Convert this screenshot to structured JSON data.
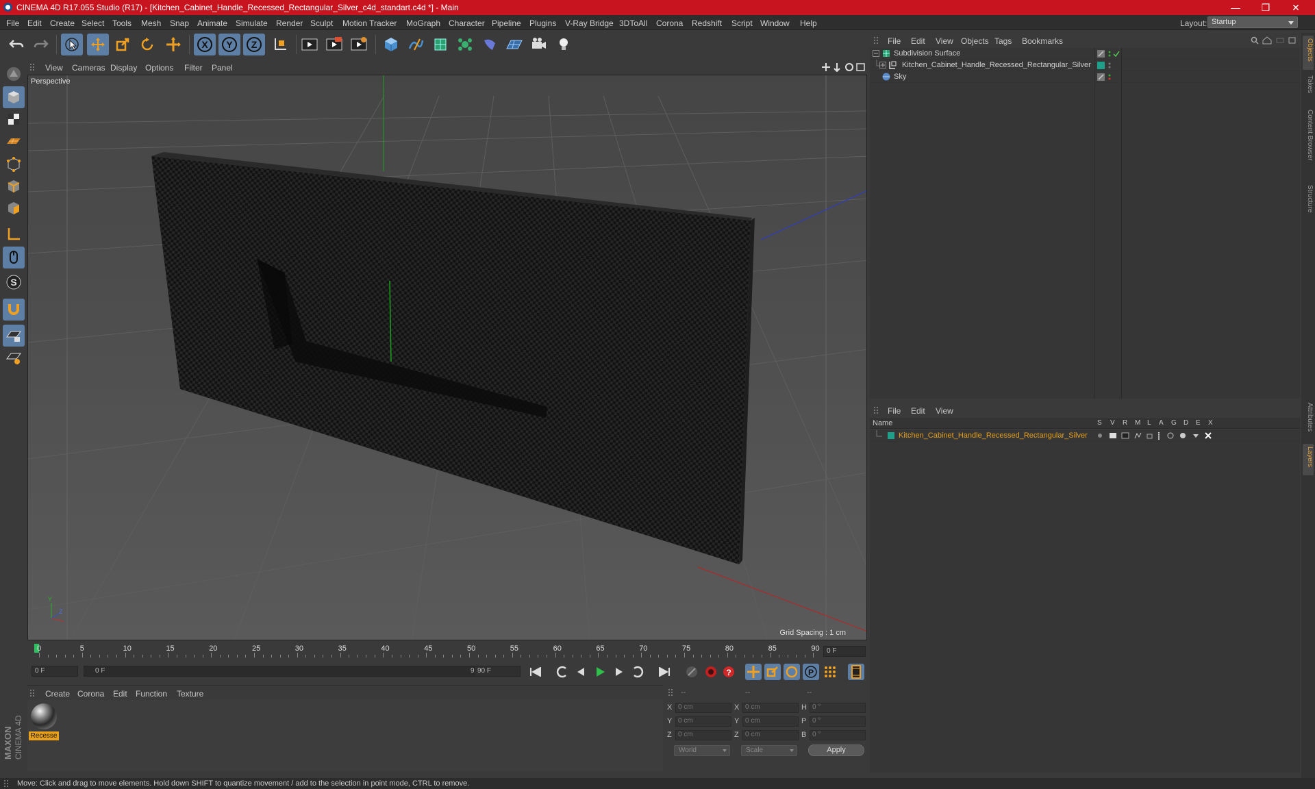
{
  "window": {
    "title": "CINEMA 4D R17.055 Studio (R17) - [Kitchen_Cabinet_Handle_Recessed_Rectangular_Silver_c4d_standart.c4d *] - Main"
  },
  "menubar": {
    "items": [
      "File",
      "Edit",
      "Create",
      "Select",
      "Tools",
      "Mesh",
      "Snap",
      "Animate",
      "Simulate",
      "Render",
      "Sculpt",
      "Motion Tracker",
      "MoGraph",
      "Character",
      "Pipeline",
      "Plugins",
      "V-Ray Bridge",
      "3DToAll",
      "Corona",
      "Redshift",
      "Script",
      "Window",
      "Help"
    ],
    "layout_label": "Layout:",
    "layout_value": "Startup"
  },
  "viewport": {
    "menu": [
      "View",
      "Cameras",
      "Display",
      "Options",
      "Filter",
      "Panel"
    ],
    "label": "Perspective",
    "grid_spacing": "Grid Spacing : 1 cm"
  },
  "timeline": {
    "ticks": [
      "0",
      "5",
      "10",
      "15",
      "20",
      "25",
      "30",
      "35",
      "40",
      "45",
      "50",
      "55",
      "60",
      "65",
      "70",
      "75",
      "80",
      "85",
      "90"
    ],
    "current_frame": "0 F",
    "start_field": "0 F",
    "slider_start": "0 F",
    "slider_end": "90 F",
    "end_field": "90 F"
  },
  "material_panel": {
    "menu": [
      "Create",
      "Corona",
      "Edit",
      "Function",
      "Texture"
    ],
    "material_name": "Recesse"
  },
  "coords": {
    "headers": [
      "--",
      "--",
      "--"
    ],
    "rows": [
      {
        "l1": "X",
        "v1": "0 cm",
        "l2": "X",
        "v2": "0 cm",
        "l3": "H",
        "v3": "0 °"
      },
      {
        "l1": "Y",
        "v1": "0 cm",
        "l2": "Y",
        "v2": "0 cm",
        "l3": "P",
        "v3": "0 °"
      },
      {
        "l1": "Z",
        "v1": "0 cm",
        "l2": "Z",
        "v2": "0 cm",
        "l3": "B",
        "v3": "0 °"
      }
    ],
    "world": "World",
    "scale": "Scale",
    "apply": "Apply"
  },
  "object_manager": {
    "menu": [
      "File",
      "Edit",
      "View",
      "Objects",
      "Tags",
      "Bookmarks"
    ],
    "objects": [
      {
        "name": "Subdivision Surface"
      },
      {
        "name": "Kitchen_Cabinet_Handle_Recessed_Rectangular_Silver"
      },
      {
        "name": "Sky"
      }
    ]
  },
  "layer_manager": {
    "menu": [
      "File",
      "Edit",
      "View"
    ],
    "header_name": "Name",
    "columns": [
      "S",
      "V",
      "R",
      "M",
      "L",
      "A",
      "G",
      "D",
      "E",
      "X"
    ],
    "layers": [
      {
        "name": "Kitchen_Cabinet_Handle_Recessed_Rectangular_Silver"
      }
    ]
  },
  "right_tabs": [
    "Objects",
    "Takes",
    "Content Browser",
    "Structure",
    "Attributes",
    "Layers"
  ],
  "brand": {
    "line1": "MAXON",
    "line2": "CINEMA 4D"
  },
  "status": {
    "text": "Move: Click and drag to move elements. Hold down SHIFT to quantize movement / add to the selection in point mode, CTRL to remove."
  },
  "colors": {
    "title_red": "#c8141e",
    "selection_blue": "#5d7fa6",
    "layer_orange": "#e7a11d",
    "layer_teal": "#1f9e8a"
  }
}
